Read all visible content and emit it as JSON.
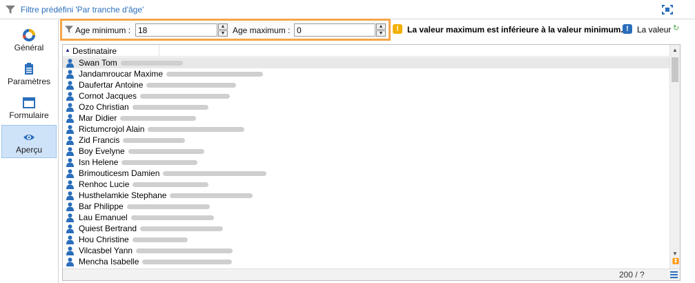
{
  "header": {
    "title": "Filtre prédéfini 'Par tranche d'âge'"
  },
  "sidebar": {
    "items": [
      {
        "label": "Général",
        "icon": "general-icon",
        "active": false
      },
      {
        "label": "Paramètres",
        "icon": "clipboard-icon",
        "active": false
      },
      {
        "label": "Formulaire",
        "icon": "form-icon",
        "active": false
      },
      {
        "label": "Aperçu",
        "icon": "eye-icon",
        "active": true
      }
    ]
  },
  "filter": {
    "min_label": "Age minimum :",
    "min_value": "18",
    "max_label": "Age maximum :",
    "max_value": "0"
  },
  "messages": {
    "warning": "La valeur maximum est inférieure à la valeur minimum.",
    "info": "La valeur"
  },
  "list": {
    "column": "Destinataire",
    "rows": [
      {
        "name": "Swan Tom",
        "blur": 90
      },
      {
        "name": "Jandamroucar Maxime",
        "blur": 140
      },
      {
        "name": "Daufertar Antoine",
        "blur": 130
      },
      {
        "name": "Cornot Jacques",
        "blur": 130
      },
      {
        "name": "Ozo Christian",
        "blur": 110
      },
      {
        "name": "Mar Didier",
        "blur": 110
      },
      {
        "name": "Rictumcrojol Alain",
        "blur": 140
      },
      {
        "name": "Zid Francis",
        "blur": 90
      },
      {
        "name": "Boy Evelyne",
        "blur": 110
      },
      {
        "name": "Isn Helene",
        "blur": 110
      },
      {
        "name": "Brimouticesm Damien",
        "blur": 150
      },
      {
        "name": "Renhoc Lucie",
        "blur": 110
      },
      {
        "name": "Husthelamkie Stephane",
        "blur": 120
      },
      {
        "name": "Bar Philippe",
        "blur": 120
      },
      {
        "name": "Lau Emanuel",
        "blur": 120
      },
      {
        "name": "Quiest Bertrand",
        "blur": 120
      },
      {
        "name": "Hou Christine",
        "blur": 80
      },
      {
        "name": "Vilcasbel Yann",
        "blur": 140
      },
      {
        "name": "Mencha Isabelle",
        "blur": 130
      }
    ]
  },
  "status": {
    "count": "200 / ?"
  },
  "colors": {
    "accent": "#2a6ebb",
    "highlight": "#f5a54a",
    "warning": "#f2b100",
    "active_tab": "#cfe3f8"
  }
}
